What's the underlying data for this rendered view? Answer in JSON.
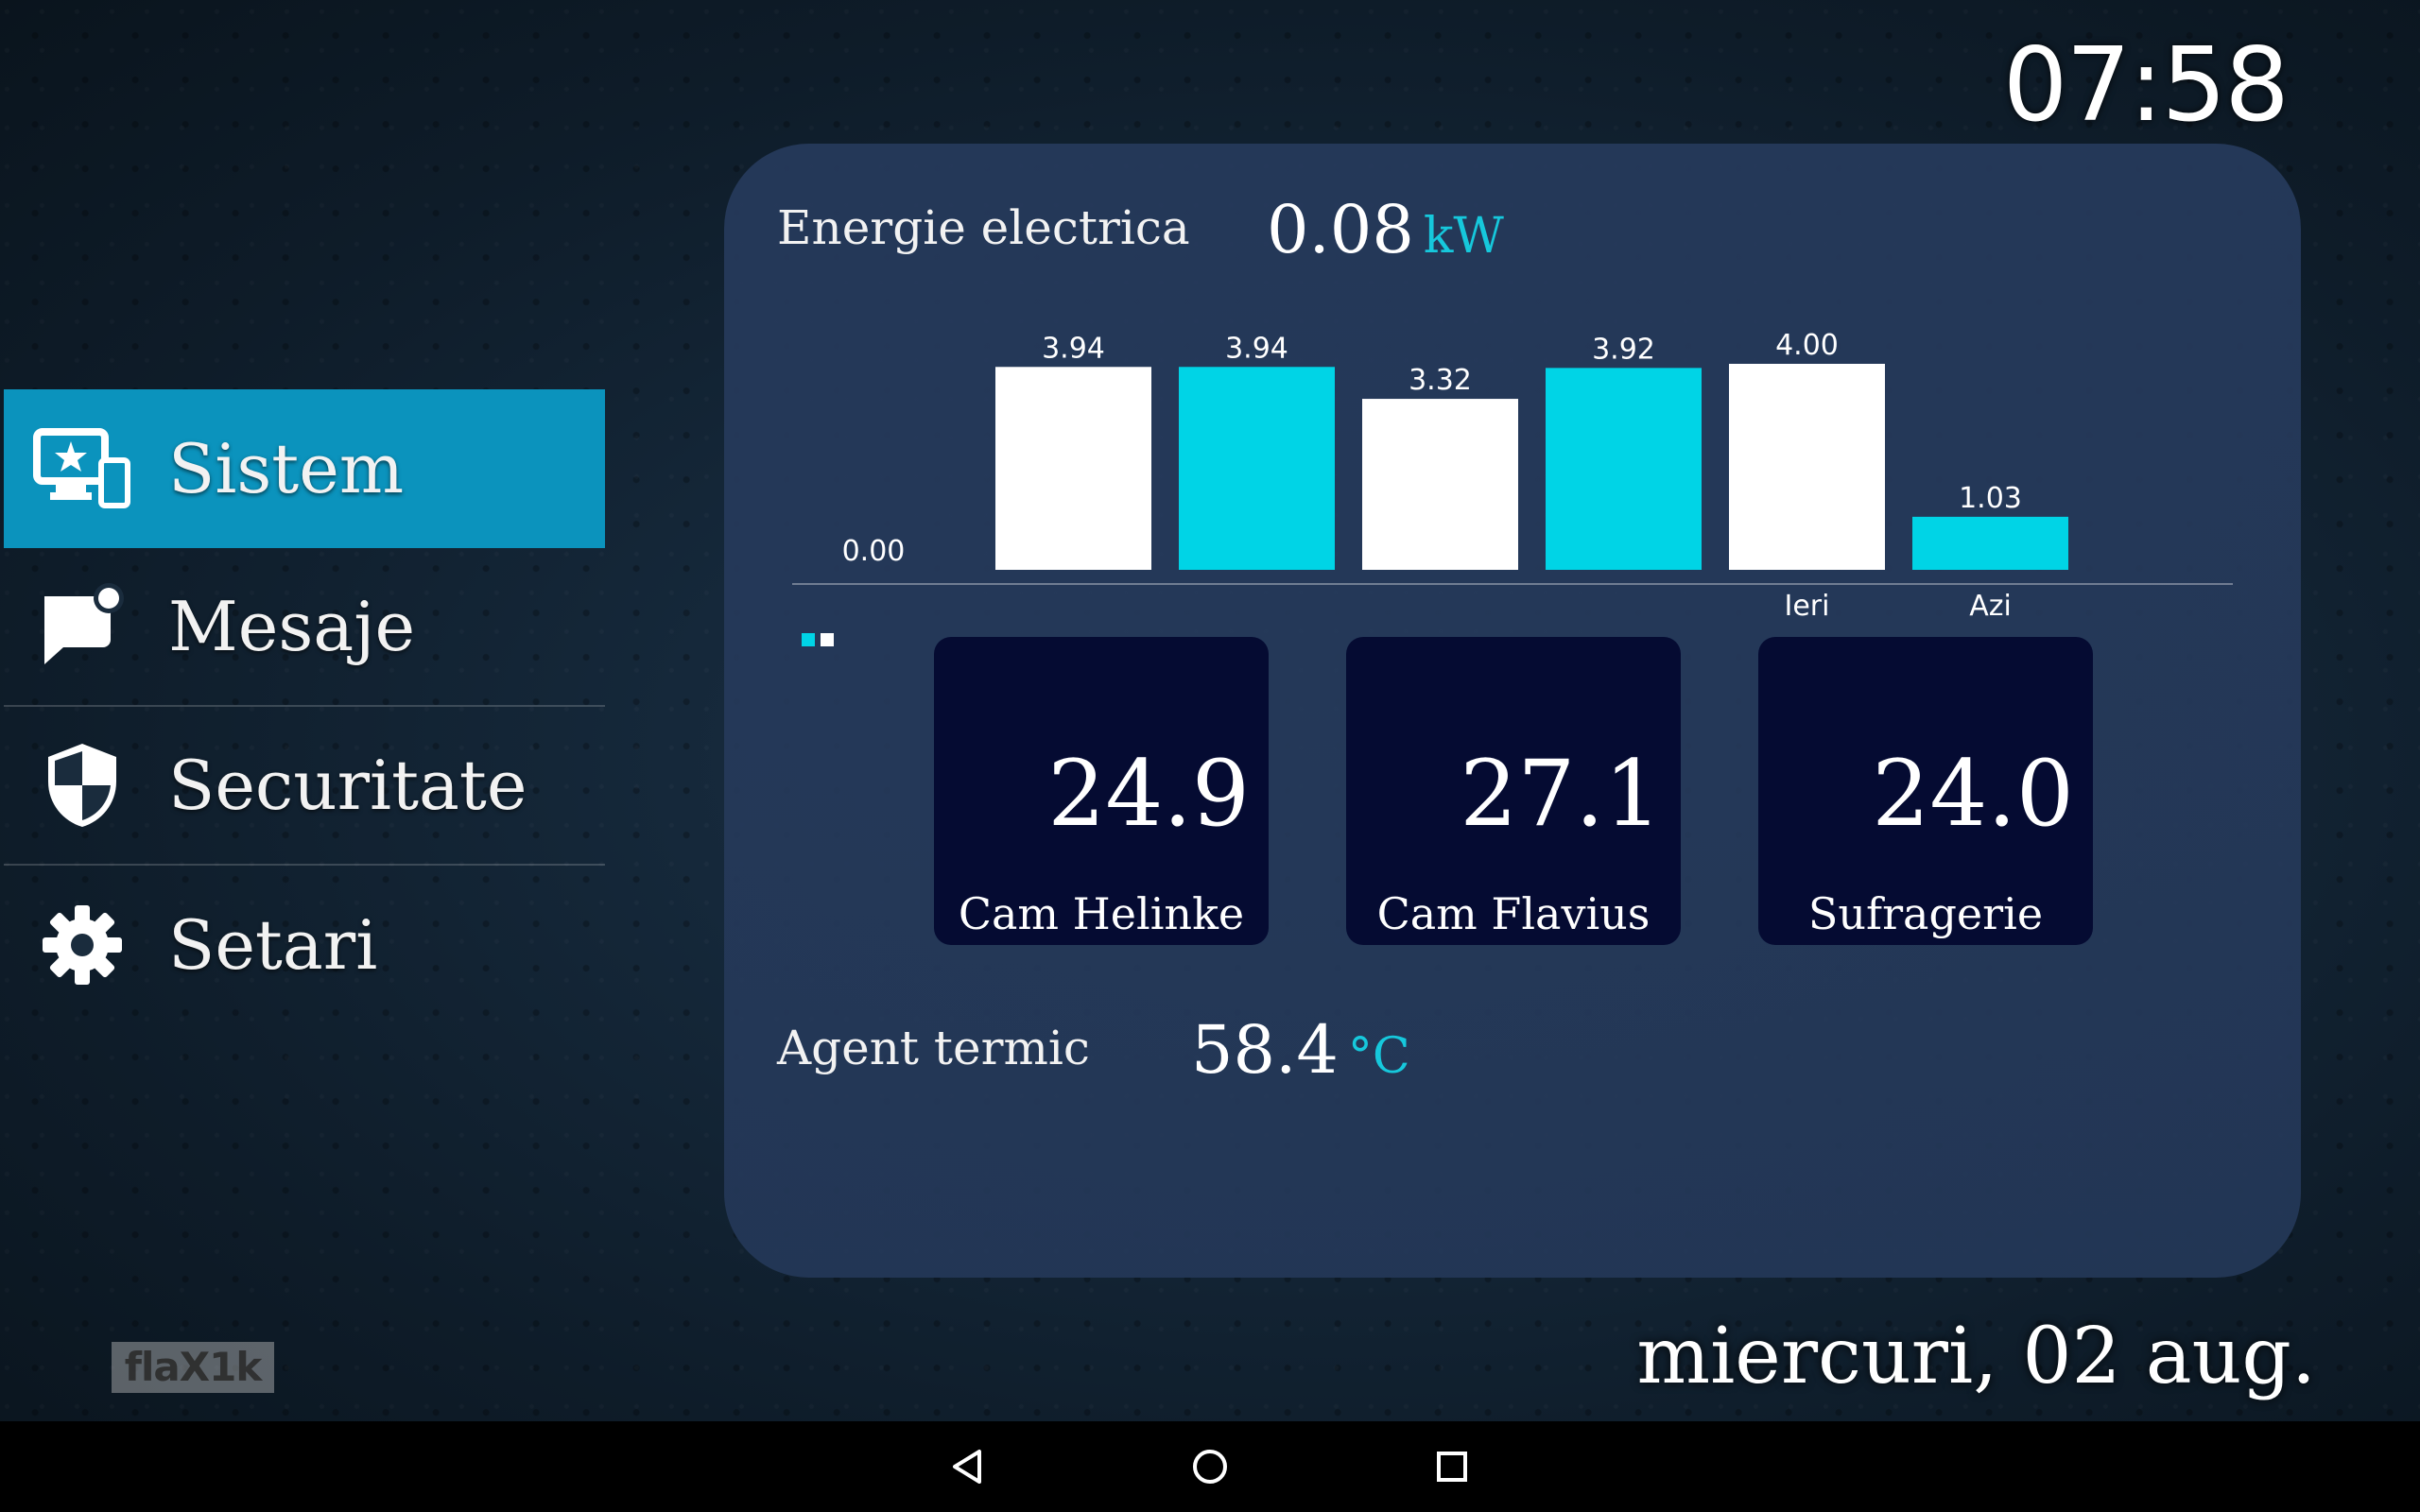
{
  "clock": "07:58",
  "date": "miercuri, 02 aug.",
  "watermark": "flaX1k",
  "menu": {
    "items": [
      {
        "label": "Sistem",
        "icon": "devices-star-icon",
        "active": true
      },
      {
        "label": "Mesaje",
        "icon": "message-notification-icon",
        "active": false
      },
      {
        "label": "Securitate",
        "icon": "shield-icon",
        "active": false
      },
      {
        "label": "Setari",
        "icon": "gear-icon",
        "active": false
      }
    ]
  },
  "energy": {
    "title": "Energie electrica",
    "value": "0.08",
    "unit": "kW"
  },
  "chart_data": {
    "type": "bar",
    "categories": [
      "",
      "",
      "",
      "",
      "",
      "Ieri",
      "Azi"
    ],
    "values": [
      0.0,
      3.94,
      3.94,
      3.32,
      3.92,
      4.0,
      1.03
    ],
    "value_labels": [
      "0.00",
      "3.94",
      "3.94",
      "3.32",
      "3.92",
      "4.00",
      "1.03"
    ],
    "colors": [
      "#ffffff",
      "#ffffff",
      "#00d4e6",
      "#ffffff",
      "#00d4e6",
      "#ffffff",
      "#00d4e6"
    ],
    "ylim": [
      0,
      4.0
    ],
    "legend_colors": [
      "#00d4e6",
      "#ffffff"
    ]
  },
  "tiles": [
    {
      "value": "24.9",
      "room": "Cam Helinke"
    },
    {
      "value": "27.1",
      "room": "Cam Flavius"
    },
    {
      "value": "24.0",
      "room": "Sufragerie"
    }
  ],
  "agent": {
    "label": "Agent termic",
    "value": "58.4",
    "unit": "°C"
  },
  "colors": {
    "accent": "#0b93bd",
    "cyan": "#00d4e6",
    "tile_bg": "#050b32"
  },
  "navbar": {
    "buttons": [
      "back-icon",
      "home-icon",
      "recents-icon"
    ]
  }
}
